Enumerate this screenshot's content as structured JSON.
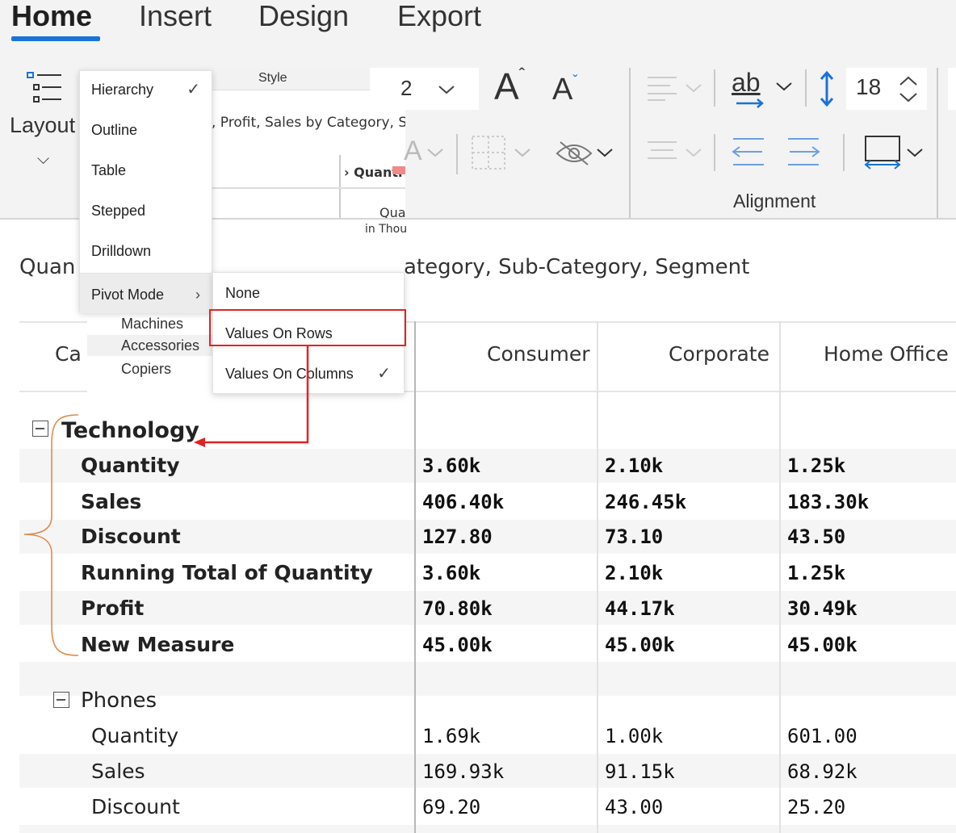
{
  "ribbon": {
    "tabs": [
      {
        "label": "Home",
        "active": true
      },
      {
        "label": "Insert",
        "active": false
      },
      {
        "label": "Design",
        "active": false
      },
      {
        "label": "Export",
        "active": false
      }
    ],
    "layout_label": "Layout",
    "style_label": "Style",
    "style_preview_text": ", Profit, Sales by Category, Su",
    "style_preview_col": "Quanti",
    "style_preview_cell_line1": "Qua",
    "style_preview_cell_line2": "in Thou",
    "font_size_partial": "2",
    "line_spacing_value": "18",
    "alignment_label": "Alignment",
    "accent_color": "#1a73d8"
  },
  "menu": {
    "items": [
      {
        "label": "Hierarchy",
        "checked": true
      },
      {
        "label": "Outline",
        "checked": false
      },
      {
        "label": "Table",
        "checked": false
      },
      {
        "label": "Stepped",
        "checked": false
      },
      {
        "label": "Drilldown",
        "checked": false
      },
      {
        "label": "Pivot Mode",
        "has_submenu": true
      }
    ],
    "submenu": [
      {
        "label": "None",
        "checked": false
      },
      {
        "label": "Values On Rows",
        "checked": false,
        "highlighted": true
      },
      {
        "label": "Values On Columns",
        "checked": true
      }
    ],
    "behind_items": [
      "Machines",
      "Accessories",
      "Copiers"
    ]
  },
  "report": {
    "title_start": "Quan",
    "title_end": "ategory, Sub-Category, Segment",
    "category_header": "Ca",
    "columns": [
      "Consumer",
      "Corporate",
      "Home Office"
    ],
    "groups": [
      {
        "name": "Technology",
        "rows": [
          {
            "label": "Quantity",
            "values": [
              "3.60k",
              "2.10k",
              "1.25k"
            ]
          },
          {
            "label": "Sales",
            "values": [
              "406.40k",
              "246.45k",
              "183.30k"
            ]
          },
          {
            "label": "Discount",
            "values": [
              "127.80",
              "73.10",
              "43.50"
            ]
          },
          {
            "label": "Running Total of Quantity",
            "values": [
              "3.60k",
              "2.10k",
              "1.25k"
            ]
          },
          {
            "label": "Profit",
            "values": [
              "70.80k",
              "44.17k",
              "30.49k"
            ]
          },
          {
            "label": "New Measure",
            "values": [
              "45.00k",
              "45.00k",
              "45.00k"
            ]
          }
        ]
      },
      {
        "name": "Phones",
        "rows": [
          {
            "label": "Quantity",
            "values": [
              "1.69k",
              "1.00k",
              "601.00"
            ]
          },
          {
            "label": "Sales",
            "values": [
              "169.93k",
              "91.15k",
              "68.92k"
            ]
          },
          {
            "label": "Discount",
            "values": [
              "69.20",
              "43.00",
              "25.20"
            ]
          }
        ]
      }
    ]
  },
  "annotation": {
    "color": "#e02424",
    "brace_color": "#e08a4a"
  }
}
